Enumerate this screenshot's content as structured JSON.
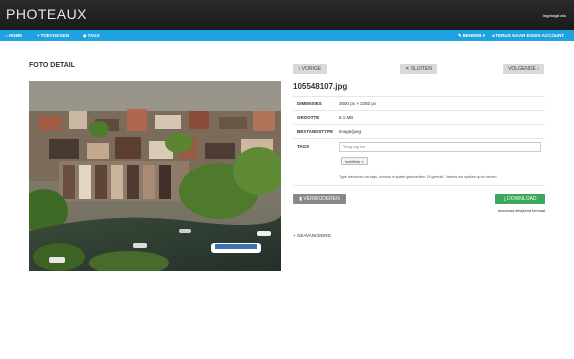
{
  "app": {
    "brand": "PHOTEAUX",
    "user": "Ingelogd als"
  },
  "nav": {
    "home": "HOME",
    "add": "TOEVOEGEN",
    "tags": "TAGS",
    "manage": "BEHEER",
    "back_account": "TERUG NAAR EIGEN ACCOUNT"
  },
  "page": {
    "title": "FOTO DETAIL"
  },
  "actions": {
    "prev": "VORIGE",
    "close": "SLUITEN",
    "next": "VOLGENDE"
  },
  "photo": {
    "filename": "105548107.jpg",
    "properties": [
      {
        "label": "DIMENSIES",
        "value": "3000 px × 2250 px"
      },
      {
        "label": "GROOTTE",
        "value": "6.1 MB"
      },
      {
        "label": "BESTANDSTYPE",
        "value": "image/jpeg"
      }
    ],
    "tags_label": "TAGS",
    "tag_placeholder": "Voeg tag toe",
    "tags": [
      "luchtfoto"
    ],
    "tag_help": "Type hierboven uw tags, komma of spatie gescheiden. Of gebruik \" tekens om spaties op te nemen"
  },
  "buttons": {
    "delete": "VERWIJDEREN",
    "download": "DOWNLOAD",
    "alt_format": "download afwijkend formaat"
  },
  "advanced": "GEAVANCEERD",
  "icons": {
    "home": "home-icon",
    "plus": "plus-icon",
    "tag": "tag-icon",
    "wrench": "wrench-icon",
    "back": "arrow-left-icon",
    "prev": "chevron-left-icon",
    "close": "close-icon",
    "next": "chevron-right-icon",
    "trash": "trash-icon",
    "download": "download-icon",
    "plus-small": "plus-icon"
  },
  "colors": {
    "topbar": "#1f1f1f",
    "navbar": "#1fa3e0",
    "download": "#3aa856",
    "delete": "#888888"
  }
}
